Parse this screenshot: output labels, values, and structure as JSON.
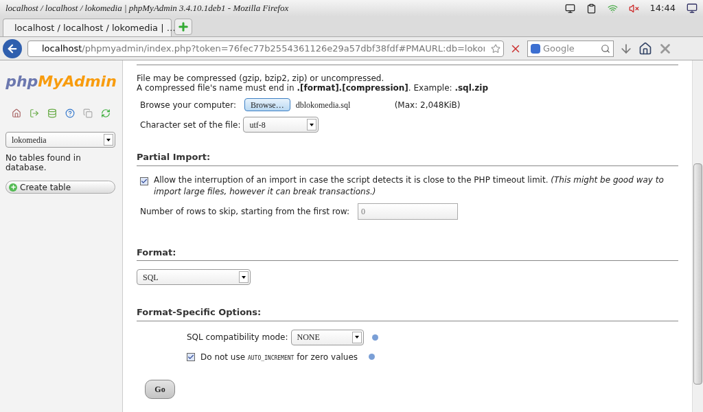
{
  "window": {
    "title": "localhost / localhost / lokomedia | phpMyAdmin 3.4.10.1deb1 - Mozilla Firefox"
  },
  "system_tray": {
    "clock": "14:44"
  },
  "tabs": [
    {
      "label": "localhost / localhost / lokomedia | …",
      "selected": true
    }
  ],
  "address_bar": {
    "host": "localhost",
    "path": "/phpmyadmin/index.php?token=76fec77b2554361126e29a57dbf38fdf#PMAURL:db=lokoı"
  },
  "search": {
    "placeholder": "Google"
  },
  "sidebar": {
    "logo_prefix": "php",
    "logo_main": "MyAdmin",
    "database": "lokomedia",
    "message": "No tables found in database.",
    "create_button": "Create table"
  },
  "file_import": {
    "line1": "File may be compressed (gzip, bzip2, zip) or uncompressed.",
    "line2": "A compressed file's name must end in **.[format].[compression]**. Example: **.sql.zip**",
    "browse_label": "Browse your computer:",
    "browse_button": "Browse…",
    "file_name": "dblokomedia.sql",
    "max_size": "(Max: 2,048KiB)",
    "charset_label": "Character set of the file:",
    "charset": "utf-8"
  },
  "partial_import": {
    "heading": "Partial Import:",
    "allow_checked": true,
    "allow_text": "Allow the interruption of an import in case the script detects it is close to the PHP timeout limit. *(This might be good way to import large files, however it can break transactions.)*",
    "skip_label": "Number of rows to skip, starting from the first row:",
    "skip_value": "0"
  },
  "format": {
    "heading": "Format:",
    "value": "SQL"
  },
  "format_options": {
    "heading": "Format-Specific Options:",
    "compat_label": "SQL compatibility mode:",
    "compat_value": "NONE",
    "auto_checked": true,
    "auto_before": "Do not use",
    "auto_code": "AUTO_INCREMENT",
    "auto_after": "for zero values"
  },
  "go_button": "Go"
}
